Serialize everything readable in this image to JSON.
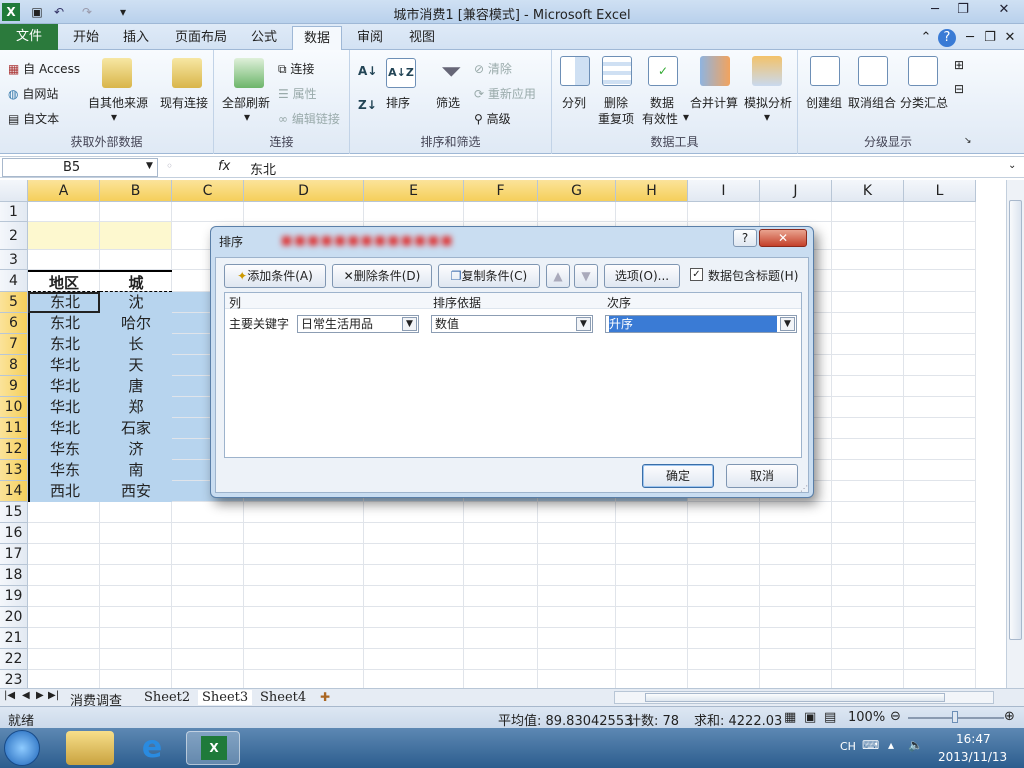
{
  "window": {
    "title": "城市消费1  [兼容模式] - Microsoft Excel"
  },
  "ribbon_tabs": [
    "文件",
    "开始",
    "插入",
    "页面布局",
    "公式",
    "数据",
    "审阅",
    "视图"
  ],
  "ribbon": {
    "get_external": {
      "access": "自 Access",
      "web": "自网站",
      "text": "自文本",
      "other": "自其他来源",
      "existing": "现有连接",
      "label": "获取外部数据"
    },
    "connections": {
      "refresh_all": "全部刷新",
      "connections": "连接",
      "properties": "属性",
      "edit_links": "编辑链接",
      "label": "连接"
    },
    "sort_filter": {
      "sort_az": "A↓Z",
      "sort": "排序",
      "filter": "筛选",
      "clear": "清除",
      "reapply": "重新应用",
      "advanced": "高级",
      "label": "排序和筛选"
    },
    "data_tools": {
      "text_to_cols": "分列",
      "remove_dup_1": "删除",
      "remove_dup_2": "重复项",
      "validation_1": "数据",
      "validation_2": "有效性",
      "consolidate": "合并计算",
      "whatif": "模拟分析",
      "label": "数据工具"
    },
    "outline": {
      "group": "创建组",
      "ungroup": "取消组合",
      "subtotal": "分类汇总",
      "label": "分级显示"
    }
  },
  "formula_bar": {
    "namebox": "B5",
    "fx": "fx",
    "content": "东北"
  },
  "columns": [
    "A",
    "B",
    "C",
    "D",
    "E",
    "F",
    "G",
    "H",
    "I",
    "J",
    "K",
    "L"
  ],
  "rows": [
    "1",
    "2",
    "3",
    "4",
    "5",
    "6",
    "7",
    "8",
    "9",
    "10",
    "11",
    "12",
    "13",
    "14",
    "15",
    "16",
    "17",
    "18",
    "19",
    "20",
    "21",
    "22",
    "23"
  ],
  "table": {
    "header": [
      "地区",
      "城"
    ],
    "regions": [
      "东北",
      "东北",
      "东北",
      "华北",
      "华北",
      "华北",
      "华北",
      "华东",
      "华东",
      "西北"
    ],
    "cities_partial": [
      "沈",
      "哈尔",
      "长",
      "天",
      "唐",
      "郑",
      "石家",
      "济",
      "南",
      "西安"
    ]
  },
  "dialog": {
    "title": "排序",
    "help": "?",
    "close": "✕",
    "add_condition": "添加条件(A)",
    "delete_condition": "删除条件(D)",
    "copy_condition": "复制条件(C)",
    "options": "选项(O)...",
    "header_checkbox": "数据包含标题(H)",
    "col_header": "列",
    "sort_on_header": "排序依据",
    "order_header": "次序",
    "row_label": "主要关键字",
    "key_value": "日常生活用品",
    "sort_on_value": "数值",
    "order_value": "升序",
    "ok": "确定",
    "cancel": "取消"
  },
  "sheets": [
    "消费调查",
    "Sheet2",
    "Sheet3",
    "Sheet4"
  ],
  "status": {
    "ready": "就绪",
    "average": "平均值: 89.83042553",
    "count": "计数: 78",
    "sum": "求和: 4222.03",
    "zoom": "100%"
  },
  "taskbar": {
    "lang": "CH",
    "time": "16:47",
    "date": "2013/11/13"
  }
}
